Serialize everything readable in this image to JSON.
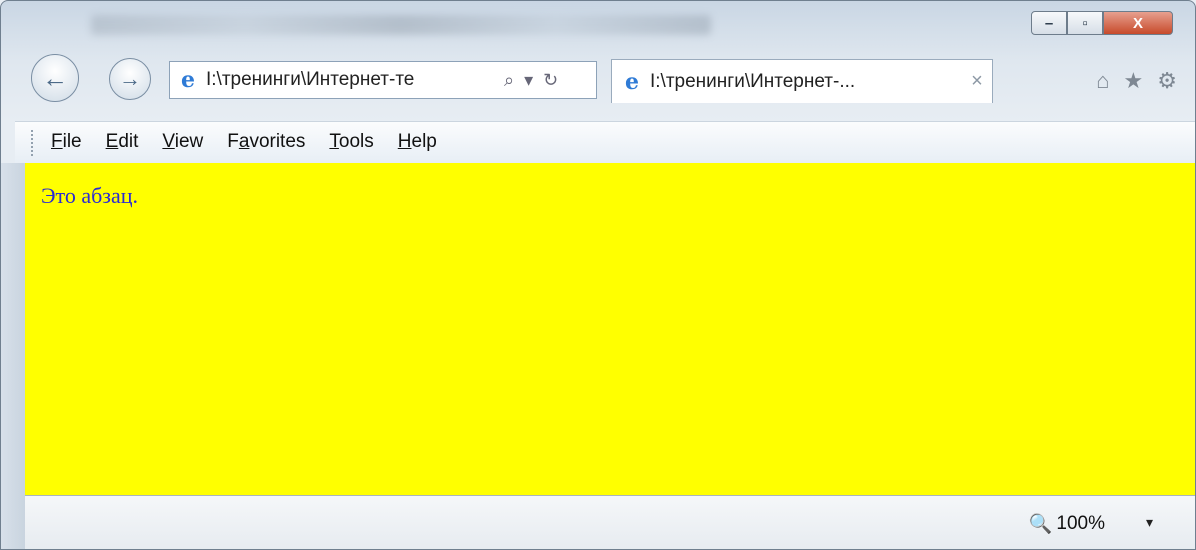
{
  "window": {
    "caption_buttons": {
      "minimize": "–",
      "maximize": "▫",
      "close": "X"
    }
  },
  "navigation": {
    "back_icon": "←",
    "forward_icon": "→"
  },
  "address_bar": {
    "url": "I:\\тренинги\\Интернет-те",
    "search_icon": "⌕",
    "dropdown_icon": "▾",
    "refresh_icon": "↻"
  },
  "tab": {
    "title": "I:\\тренинги\\Интернет-...",
    "close_icon": "×"
  },
  "toolbar_icons": {
    "home": "⌂",
    "favorites": "★",
    "tools": "⚙"
  },
  "menu": [
    {
      "label": "File",
      "accel": "F",
      "rest": "ile"
    },
    {
      "label": "Edit",
      "accel": "E",
      "rest": "dit"
    },
    {
      "label": "View",
      "accel": "V",
      "rest": "iew"
    },
    {
      "label": "Favorites",
      "pre": "F",
      "accel": "a",
      "rest": "vorites"
    },
    {
      "label": "Tools",
      "accel": "T",
      "rest": "ools"
    },
    {
      "label": "Help",
      "accel": "H",
      "rest": "elp"
    }
  ],
  "page": {
    "background": "#ffff00",
    "text_color": "#2b2bd3",
    "paragraph": "Это абзац."
  },
  "status": {
    "zoom": "100%",
    "zoom_icon": "🔍",
    "dropdown_icon": "▾"
  }
}
